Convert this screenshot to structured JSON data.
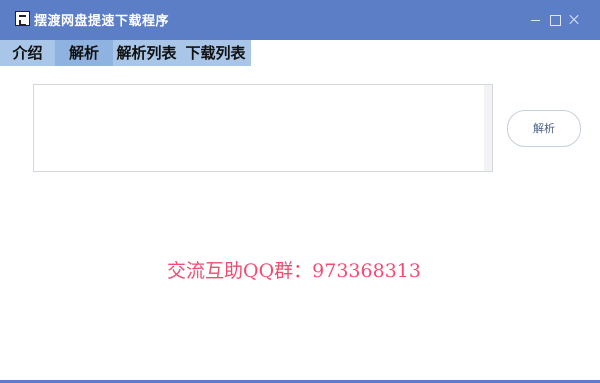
{
  "window": {
    "title": "摆渡网盘提速下载程序",
    "controls": [
      "minimize-icon",
      "maximize-icon",
      "close-icon"
    ],
    "title_bar_color": "#5b7ec7"
  },
  "tabs": [
    {
      "label": "介绍"
    },
    {
      "label": "解析",
      "active": true
    },
    {
      "label": "解析列表"
    },
    {
      "label": "下载列表"
    }
  ],
  "main": {
    "link_input": {
      "value": "",
      "placeholder": ""
    },
    "parse_button_label": "解析",
    "banner": "交流互助QQ群：973368313",
    "banner_color": "#ef4e72"
  }
}
